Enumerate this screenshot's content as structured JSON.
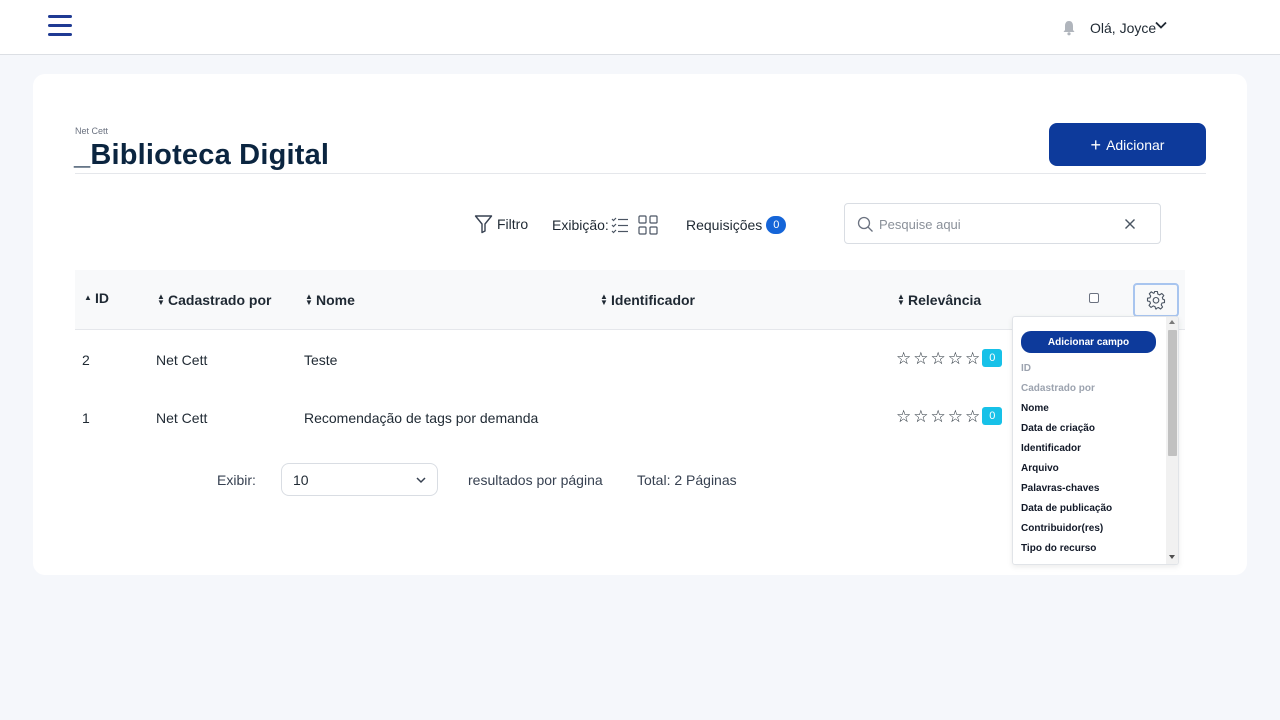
{
  "header": {
    "menu_icon": "hamburger-menu-icon",
    "notification_icon": "bell-icon",
    "greeting": "Olá, Joyce",
    "user_menu_icon": "chevron-down-icon"
  },
  "page": {
    "company": "Net Cett",
    "title": "_Biblioteca Digital",
    "add_button": "Adicionar",
    "add_icon": "+"
  },
  "toolbar": {
    "filter_label": "Filtro",
    "display_label": "Exibição:",
    "requests_label": "Requisições",
    "requests_count": "0",
    "search_placeholder": "Pesquise aqui",
    "search_value": ""
  },
  "table": {
    "columns": [
      {
        "label": "ID",
        "sort": "asc"
      },
      {
        "label": "Cadastrado por",
        "sort": "both"
      },
      {
        "label": "Nome",
        "sort": "both"
      },
      {
        "label": "Identificador",
        "sort": "both"
      },
      {
        "label": "Relevância",
        "sort": "both"
      }
    ],
    "rows": [
      {
        "id": "2",
        "registered_by": "Net Cett",
        "name": "Teste",
        "identifier": "",
        "rating": 0,
        "rating_count": "0"
      },
      {
        "id": "1",
        "registered_by": "Net Cett",
        "name": "Recomendação de tags por demanda",
        "identifier": "",
        "rating": 0,
        "rating_count": "0"
      }
    ]
  },
  "pagination": {
    "show_label": "Exibir:",
    "per_page_value": "10",
    "per_page_suffix": "resultados por página",
    "total_label": "Total: 2 Páginas"
  },
  "column_menu": {
    "add_field_button": "Adicionar campo",
    "items": [
      {
        "label": "ID",
        "enabled": false
      },
      {
        "label": "Cadastrado por",
        "enabled": false
      },
      {
        "label": "Nome",
        "enabled": true
      },
      {
        "label": "Data de criação",
        "enabled": true
      },
      {
        "label": "Identificador",
        "enabled": true
      },
      {
        "label": "Arquivo",
        "enabled": true
      },
      {
        "label": "Palavras-chaves",
        "enabled": true
      },
      {
        "label": "Data de publicação",
        "enabled": true
      },
      {
        "label": "Contribuidor(res)",
        "enabled": true
      },
      {
        "label": "Tipo do recurso",
        "enabled": true
      }
    ]
  },
  "colors": {
    "primary": "#0d3a9b",
    "badge_blue": "#1565d8",
    "badge_cyan": "#17c1e8",
    "title": "#0b2540"
  }
}
